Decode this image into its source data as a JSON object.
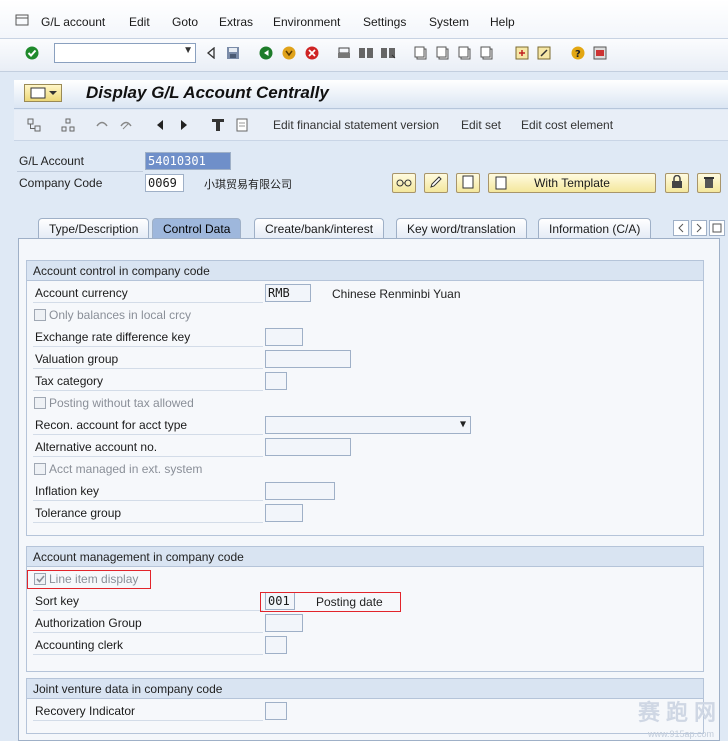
{
  "menubar": {
    "items": [
      "G/L account",
      "Edit",
      "Goto",
      "Extras",
      "Environment",
      "Settings",
      "System",
      "Help"
    ]
  },
  "header": {
    "title": "Display G/L Account Centrally"
  },
  "app_toolbar": {
    "edit_fs_version": "Edit financial statement version",
    "edit_set": "Edit set",
    "edit_cost_element": "Edit cost element"
  },
  "keyfields": {
    "gl_account_label": "G/L Account",
    "gl_account_value": "54010301",
    "company_code_label": "Company Code",
    "company_code_value": "0069",
    "company_name": "小琪贸易有限公司",
    "with_template": "With Template"
  },
  "tabs": [
    {
      "label": "Type/Description"
    },
    {
      "label": "Control Data"
    },
    {
      "label": "Create/bank/interest"
    },
    {
      "label": "Key word/translation"
    },
    {
      "label": "Information (C/A)"
    }
  ],
  "account_control": {
    "title": "Account control in company code",
    "account_currency_label": "Account currency",
    "account_currency_value": "RMB",
    "currency_desc": "Chinese Renminbi Yuan",
    "only_balances": "Only balances in local crcy",
    "exchange_rate_key": "Exchange rate difference key",
    "valuation_group": "Valuation group",
    "tax_category": "Tax category",
    "posting_without_tax": "Posting without tax allowed",
    "recon_account": "Recon. account for acct type",
    "alt_account": "Alternative account no.",
    "acct_managed_ext": "Acct managed in ext. system",
    "inflation_key": "Inflation key",
    "tolerance_group": "Tolerance group"
  },
  "account_mgmt": {
    "title": "Account management in company code",
    "line_item_display": "Line item display",
    "sort_key_label": "Sort key",
    "sort_key_value": "001",
    "sort_key_desc": "Posting date",
    "auth_group": "Authorization Group",
    "accounting_clerk": "Accounting clerk"
  },
  "joint_venture": {
    "title": "Joint venture data in company code",
    "recovery_indicator": "Recovery Indicator"
  },
  "watermark": {
    "text": "赛跑网",
    "url": "www.915ap.com"
  }
}
